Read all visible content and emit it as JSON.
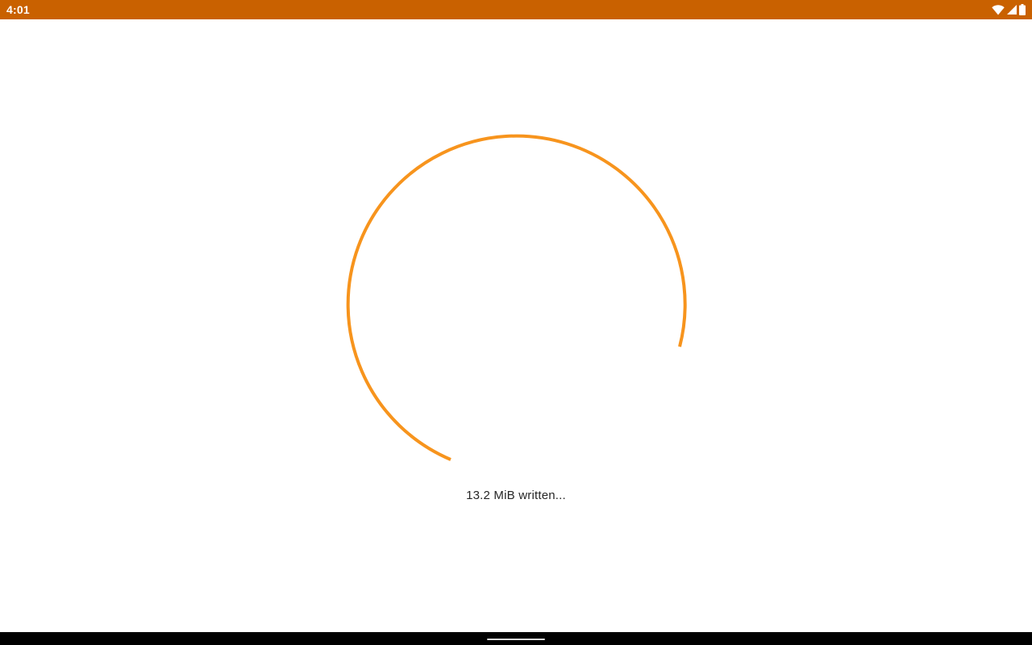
{
  "status_bar": {
    "time": "4:01",
    "background_color": "#c96100",
    "icons": [
      "wifi-icon",
      "cellular-signal-icon",
      "battery-icon"
    ]
  },
  "progress": {
    "type": "indeterminate-circular-spinner",
    "color": "#f7941d",
    "label": "13.2 MiB written..."
  },
  "navigation": {
    "handle": "home-gesture-handle"
  }
}
